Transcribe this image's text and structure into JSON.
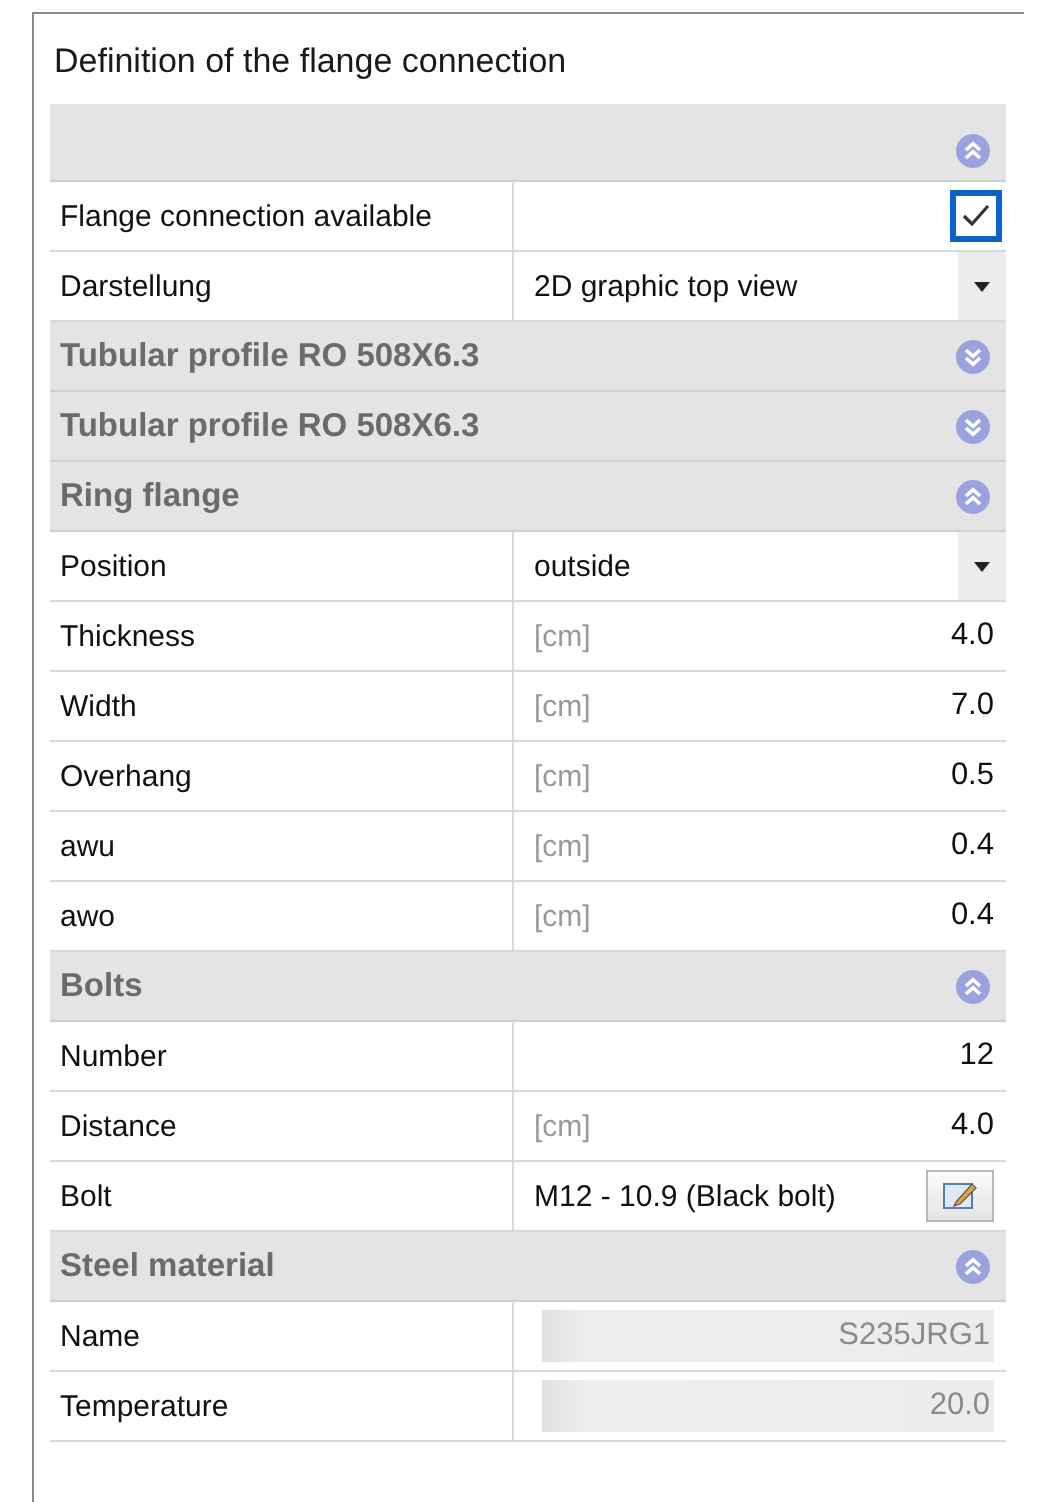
{
  "window": {
    "title": "Definition of the flange connection"
  },
  "sections": [
    {
      "expanded": true,
      "rows": [
        {
          "kind": "checkbox",
          "label": "Flange connection available",
          "checked": true
        },
        {
          "kind": "dropdown",
          "label": "Darstellung",
          "value": "2D graphic top view"
        }
      ]
    },
    {
      "title": "Tubular profile RO 508X6.3",
      "expanded": false
    },
    {
      "title": "Tubular profile RO 508X6.3",
      "expanded": false
    },
    {
      "title": "Ring flange",
      "expanded": true,
      "rows": [
        {
          "kind": "dropdown",
          "label": "Position",
          "value": "outside"
        },
        {
          "kind": "number",
          "label": "Thickness",
          "unit": "[cm]",
          "value": "4.0",
          "disabled": false
        },
        {
          "kind": "number",
          "label": "Width",
          "unit": "[cm]",
          "value": "7.0",
          "disabled": false
        },
        {
          "kind": "number",
          "label": "Overhang",
          "unit": "[cm]",
          "value": "0.5",
          "disabled": false
        },
        {
          "kind": "number",
          "label": "awu",
          "unit": "[cm]",
          "value": "0.4",
          "disabled": false
        },
        {
          "kind": "number",
          "label": "awo",
          "unit": "[cm]",
          "value": "0.4",
          "disabled": false
        }
      ]
    },
    {
      "title": "Bolts",
      "expanded": true,
      "rows": [
        {
          "kind": "number",
          "label": "Number",
          "value": "12",
          "disabled": false
        },
        {
          "kind": "number",
          "label": "Distance",
          "unit": "[cm]",
          "value": "4.0",
          "disabled": false
        },
        {
          "kind": "picker",
          "label": "Bolt",
          "value": "M12 - 10.9 (Black bolt)"
        }
      ]
    },
    {
      "title": "Steel material",
      "expanded": true,
      "rows": [
        {
          "kind": "number",
          "label": "Name",
          "value": "S235JRG1",
          "disabled": true
        },
        {
          "kind": "number",
          "label": "Temperature",
          "value": "20.0",
          "disabled": true
        }
      ]
    }
  ]
}
